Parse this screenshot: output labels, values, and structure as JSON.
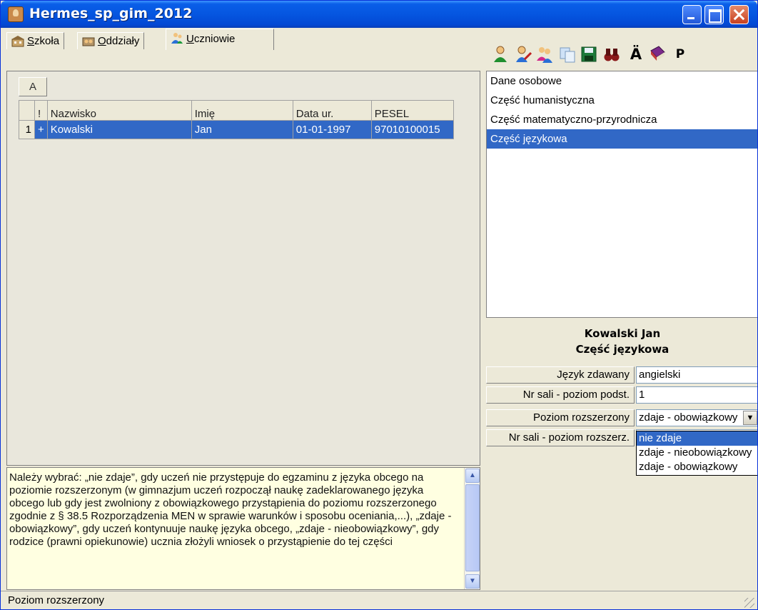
{
  "window": {
    "title": "Hermes_sp_gim_2012"
  },
  "tabs": [
    {
      "label": "Szkoła",
      "underline": "S",
      "rest": "zkoła"
    },
    {
      "label": "Oddziały",
      "underline": "O",
      "rest": "ddziały"
    },
    {
      "label": "Uczniowie",
      "underline": "U",
      "rest": "czniowie"
    }
  ],
  "grid": {
    "group_header": "A",
    "columns": [
      "!",
      "Nazwisko",
      "Imię",
      "Data ur.",
      "PESEL"
    ],
    "rows": [
      {
        "no": "1",
        "flag": "+",
        "nazwisko": "Kowalski",
        "imie": "Jan",
        "data_ur": "01-01-1997",
        "pesel": "97010100015"
      }
    ]
  },
  "help_text": "Należy wybrać: „nie zdaje”, gdy uczeń nie przystępuje do egzaminu z języka obcego na poziomie rozszerzonym (w gimnazjum uczeń rozpoczął naukę zadeklarowanego języka obcego lub gdy jest zwolniony z obowiązkowego przystąpienia do poziomu rozszerzonego zgodnie z § 38.5 Rozporządzenia MEN w sprawie warunków i sposobu oceniania,...), „zdaje - obowiązkowy”, gdy uczeń kontynuuje naukę języka obcego, „zdaje - nieobowiązkowy”, gdy rodzice (prawni opiekunowie) ucznia złożyli wniosek o przystąpienie do tej części",
  "status_bar": "Poziom rozszerzony",
  "toolbar": {
    "icons": [
      "student-icon",
      "student-edit-icon",
      "students-group-icon",
      "copy-icon",
      "save-icon",
      "binoculars-icon",
      "a-umlaut-icon",
      "book-icon",
      "p-icon"
    ],
    "a_umlaut": "Ä",
    "p_label": "P"
  },
  "sections": [
    {
      "label": "Dane osobowe",
      "selected": false
    },
    {
      "label": "Część humanistyczna",
      "selected": false
    },
    {
      "label": "Część matematyczno-przyrodnicza",
      "selected": false
    },
    {
      "label": "Część językowa",
      "selected": true
    }
  ],
  "detail": {
    "student_name": "Kowalski Jan",
    "section_name": "Część językowa",
    "fields": [
      {
        "label": "Język zdawany",
        "value": "angielski"
      },
      {
        "label": "Nr sali - poziom podst.",
        "value": "1"
      },
      {
        "label": "Poziom rozszerzony",
        "value": "zdaje - obowiązkowy"
      },
      {
        "label": "Nr sali - poziom rozszerz.",
        "value": ""
      }
    ],
    "dropdown_options": [
      {
        "label": "nie zdaje",
        "selected": true
      },
      {
        "label": "zdaje - nieobowiązkowy",
        "selected": false
      },
      {
        "label": "zdaje - obowiązkowy",
        "selected": false
      }
    ]
  },
  "colors": {
    "selection": "#3168c6",
    "help_background": "#ffffe1",
    "window_face": "#ece9d8",
    "titlebar": "#0556e0"
  }
}
